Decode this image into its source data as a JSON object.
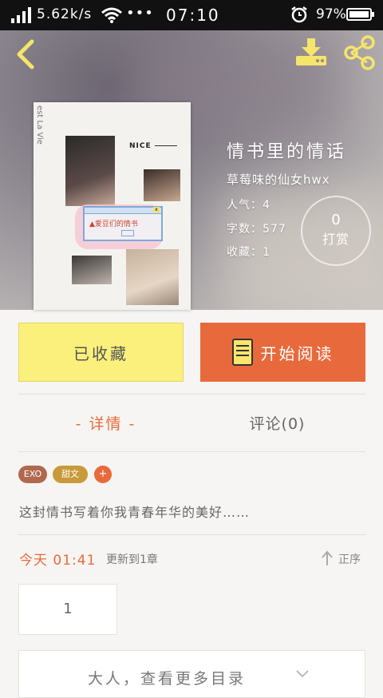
{
  "status_bar": {
    "speed": "5.62k/s",
    "dots": "•••",
    "time": "07:10",
    "battery_pct": "97%"
  },
  "book": {
    "title": "情书里的情话",
    "author": "草莓味的仙女hwx",
    "popularity": "人气：4",
    "word_count": "字数：577",
    "favorites": "收藏：1",
    "reward_count": "0",
    "reward_label": "打赏",
    "cover_side_text": "est La Vie",
    "cover_nice": "NICE",
    "cover_dialog": "▲爱豆们的情书"
  },
  "actions": {
    "collect_label": "已收藏",
    "read_label": "开始阅读"
  },
  "tabs": {
    "detail": "- 详情 -",
    "comments": "评论(0)"
  },
  "tags": [
    "EXO",
    "甜文"
  ],
  "tag_add": "+",
  "summary": "这封情书写着你我青春年华的美好……",
  "update": {
    "time": "今天 01:41",
    "text": "更新到1章",
    "sort_label": "正序"
  },
  "chapter_first": "1",
  "more_catalog": "大人，查看更多目录",
  "colors": {
    "accent": "#e86a3c",
    "collect_bg": "#fbf07b",
    "icon_yellow": "#f5e56a"
  },
  "icons": {
    "back": "chevron-left-icon",
    "download": "download-icon",
    "share": "share-icon",
    "read": "book-icon",
    "sort": "arrow-up-icon",
    "more": "chevron-down-icon"
  }
}
